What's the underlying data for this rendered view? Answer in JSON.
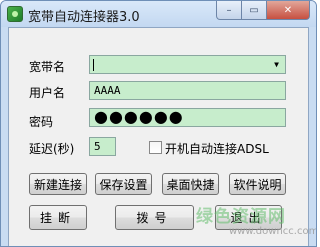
{
  "window": {
    "title": "宽带自动连接器3.0",
    "min_symbol": "–",
    "max_symbol": "▭",
    "close_symbol": "✕",
    "app_icon": "app-icon",
    "accent_color": "#c9dcf2",
    "field_color": "#c7edcc"
  },
  "form": {
    "broadband_label": "宽带名",
    "broadband_value": "",
    "broadband_arrow": "▼",
    "username_label": "用户名",
    "username_value": "AAAA",
    "password_label": "密码",
    "password_mask": "●●●●●●",
    "delay_label": "延迟(秒)",
    "delay_value": "5",
    "autoconnect_label": "开机自动连接ADSL",
    "autoconnect_checked": false
  },
  "buttons": {
    "new_connection": "新建连接",
    "save_settings": "保存设置",
    "desktop_shortcut": "桌面快捷",
    "software_help": "软件说明",
    "hang_up": "挂断",
    "dial": "拨号",
    "exit": "退出"
  },
  "watermark": {
    "main": "绿色资源网",
    "url": "www.downcc.com"
  }
}
